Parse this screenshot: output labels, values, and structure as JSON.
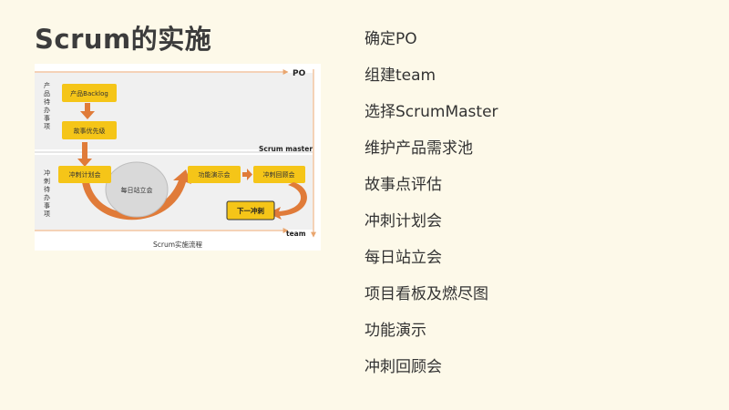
{
  "slide": {
    "title": "Scrum的实施"
  },
  "diagram": {
    "roles": {
      "po": "PO",
      "scrum_master": "Scrum  master",
      "team": "team"
    },
    "sections": {
      "backlog": "产品待办事项",
      "sprint": "冲刺待办事项"
    },
    "boxes": {
      "product_backlog": "产品Backlog",
      "stories": "故事优先级",
      "sprint_planning": "冲刺计划会",
      "daily_standup": "每日站立会",
      "demo": "功能演示会",
      "retro": "冲刺回顾会",
      "next_sprint": "下一冲刺"
    },
    "caption": "Scrum实施流程",
    "colors": {
      "box_fill": "#f5c518",
      "arrow": "#e07b39",
      "band": "#f0f0f0"
    }
  },
  "list": {
    "items": [
      "确定PO",
      "组建team",
      "选择ScrumMaster",
      "维护产品需求池",
      "故事点评估",
      "冲刺计划会",
      "每日站立会",
      "项目看板及燃尽图",
      "功能演示",
      "冲刺回顾会"
    ]
  }
}
